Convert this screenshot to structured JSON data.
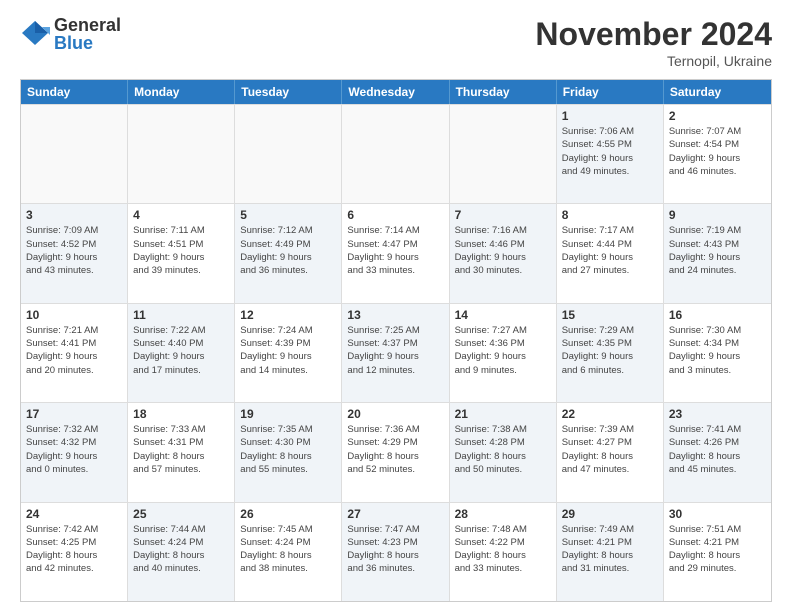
{
  "logo": {
    "general": "General",
    "blue": "Blue"
  },
  "title": "November 2024",
  "subtitle": "Ternopil, Ukraine",
  "headers": [
    "Sunday",
    "Monday",
    "Tuesday",
    "Wednesday",
    "Thursday",
    "Friday",
    "Saturday"
  ],
  "rows": [
    [
      {
        "day": "",
        "info": "",
        "empty": true
      },
      {
        "day": "",
        "info": "",
        "empty": true
      },
      {
        "day": "",
        "info": "",
        "empty": true
      },
      {
        "day": "",
        "info": "",
        "empty": true
      },
      {
        "day": "",
        "info": "",
        "empty": true
      },
      {
        "day": "1",
        "info": "Sunrise: 7:06 AM\nSunset: 4:55 PM\nDaylight: 9 hours\nand 49 minutes.",
        "shaded": true
      },
      {
        "day": "2",
        "info": "Sunrise: 7:07 AM\nSunset: 4:54 PM\nDaylight: 9 hours\nand 46 minutes.",
        "shaded": false
      }
    ],
    [
      {
        "day": "3",
        "info": "Sunrise: 7:09 AM\nSunset: 4:52 PM\nDaylight: 9 hours\nand 43 minutes.",
        "shaded": true
      },
      {
        "day": "4",
        "info": "Sunrise: 7:11 AM\nSunset: 4:51 PM\nDaylight: 9 hours\nand 39 minutes.",
        "shaded": false
      },
      {
        "day": "5",
        "info": "Sunrise: 7:12 AM\nSunset: 4:49 PM\nDaylight: 9 hours\nand 36 minutes.",
        "shaded": true
      },
      {
        "day": "6",
        "info": "Sunrise: 7:14 AM\nSunset: 4:47 PM\nDaylight: 9 hours\nand 33 minutes.",
        "shaded": false
      },
      {
        "day": "7",
        "info": "Sunrise: 7:16 AM\nSunset: 4:46 PM\nDaylight: 9 hours\nand 30 minutes.",
        "shaded": true
      },
      {
        "day": "8",
        "info": "Sunrise: 7:17 AM\nSunset: 4:44 PM\nDaylight: 9 hours\nand 27 minutes.",
        "shaded": false
      },
      {
        "day": "9",
        "info": "Sunrise: 7:19 AM\nSunset: 4:43 PM\nDaylight: 9 hours\nand 24 minutes.",
        "shaded": true
      }
    ],
    [
      {
        "day": "10",
        "info": "Sunrise: 7:21 AM\nSunset: 4:41 PM\nDaylight: 9 hours\nand 20 minutes.",
        "shaded": false
      },
      {
        "day": "11",
        "info": "Sunrise: 7:22 AM\nSunset: 4:40 PM\nDaylight: 9 hours\nand 17 minutes.",
        "shaded": true
      },
      {
        "day": "12",
        "info": "Sunrise: 7:24 AM\nSunset: 4:39 PM\nDaylight: 9 hours\nand 14 minutes.",
        "shaded": false
      },
      {
        "day": "13",
        "info": "Sunrise: 7:25 AM\nSunset: 4:37 PM\nDaylight: 9 hours\nand 12 minutes.",
        "shaded": true
      },
      {
        "day": "14",
        "info": "Sunrise: 7:27 AM\nSunset: 4:36 PM\nDaylight: 9 hours\nand 9 minutes.",
        "shaded": false
      },
      {
        "day": "15",
        "info": "Sunrise: 7:29 AM\nSunset: 4:35 PM\nDaylight: 9 hours\nand 6 minutes.",
        "shaded": true
      },
      {
        "day": "16",
        "info": "Sunrise: 7:30 AM\nSunset: 4:34 PM\nDaylight: 9 hours\nand 3 minutes.",
        "shaded": false
      }
    ],
    [
      {
        "day": "17",
        "info": "Sunrise: 7:32 AM\nSunset: 4:32 PM\nDaylight: 9 hours\nand 0 minutes.",
        "shaded": true
      },
      {
        "day": "18",
        "info": "Sunrise: 7:33 AM\nSunset: 4:31 PM\nDaylight: 8 hours\nand 57 minutes.",
        "shaded": false
      },
      {
        "day": "19",
        "info": "Sunrise: 7:35 AM\nSunset: 4:30 PM\nDaylight: 8 hours\nand 55 minutes.",
        "shaded": true
      },
      {
        "day": "20",
        "info": "Sunrise: 7:36 AM\nSunset: 4:29 PM\nDaylight: 8 hours\nand 52 minutes.",
        "shaded": false
      },
      {
        "day": "21",
        "info": "Sunrise: 7:38 AM\nSunset: 4:28 PM\nDaylight: 8 hours\nand 50 minutes.",
        "shaded": true
      },
      {
        "day": "22",
        "info": "Sunrise: 7:39 AM\nSunset: 4:27 PM\nDaylight: 8 hours\nand 47 minutes.",
        "shaded": false
      },
      {
        "day": "23",
        "info": "Sunrise: 7:41 AM\nSunset: 4:26 PM\nDaylight: 8 hours\nand 45 minutes.",
        "shaded": true
      }
    ],
    [
      {
        "day": "24",
        "info": "Sunrise: 7:42 AM\nSunset: 4:25 PM\nDaylight: 8 hours\nand 42 minutes.",
        "shaded": false
      },
      {
        "day": "25",
        "info": "Sunrise: 7:44 AM\nSunset: 4:24 PM\nDaylight: 8 hours\nand 40 minutes.",
        "shaded": true
      },
      {
        "day": "26",
        "info": "Sunrise: 7:45 AM\nSunset: 4:24 PM\nDaylight: 8 hours\nand 38 minutes.",
        "shaded": false
      },
      {
        "day": "27",
        "info": "Sunrise: 7:47 AM\nSunset: 4:23 PM\nDaylight: 8 hours\nand 36 minutes.",
        "shaded": true
      },
      {
        "day": "28",
        "info": "Sunrise: 7:48 AM\nSunset: 4:22 PM\nDaylight: 8 hours\nand 33 minutes.",
        "shaded": false
      },
      {
        "day": "29",
        "info": "Sunrise: 7:49 AM\nSunset: 4:21 PM\nDaylight: 8 hours\nand 31 minutes.",
        "shaded": true
      },
      {
        "day": "30",
        "info": "Sunrise: 7:51 AM\nSunset: 4:21 PM\nDaylight: 8 hours\nand 29 minutes.",
        "shaded": false
      }
    ]
  ]
}
